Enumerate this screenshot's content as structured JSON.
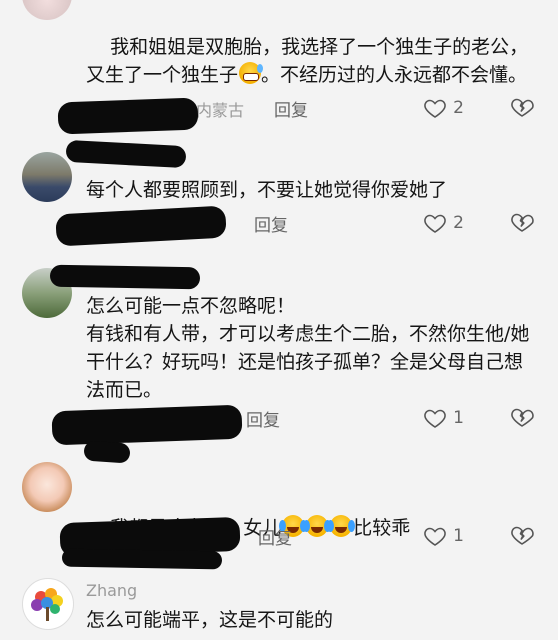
{
  "comments": [
    {
      "text_before": "我和姐姐是双胞胎，我选择了一个独生子的老公，又生了一个独生子",
      "text_after": "。不经历过的人永远都不会懂。",
      "meta_visible": "内蒙古",
      "reply": "回复",
      "likes": "2"
    },
    {
      "text": "每个人都要照顾到，不要让她觉得你爱她了",
      "reply": "回复",
      "likes": "2"
    },
    {
      "text": "怎么可能一点不忽略呢！\n有钱和有人带，才可以考虑生个二胎，不然你生他/她干什么？好玩吗！还是怕孩子孤单？全是父母自己想法而已。",
      "reply": "回复",
      "likes": "1"
    },
    {
      "text_before": "我都是疼老大，女儿",
      "text_after": "比较乖",
      "reply": "回复",
      "likes": "1"
    },
    {
      "username": "Zhang",
      "text": "怎么可能端平，这是不可能的"
    }
  ],
  "icons": {
    "like": "heart-outline-icon",
    "dislike": "broken-heart-icon",
    "emoji_sweat": "grinning-sweat-emoji",
    "emoji_cry": "laughing-tears-emoji"
  }
}
